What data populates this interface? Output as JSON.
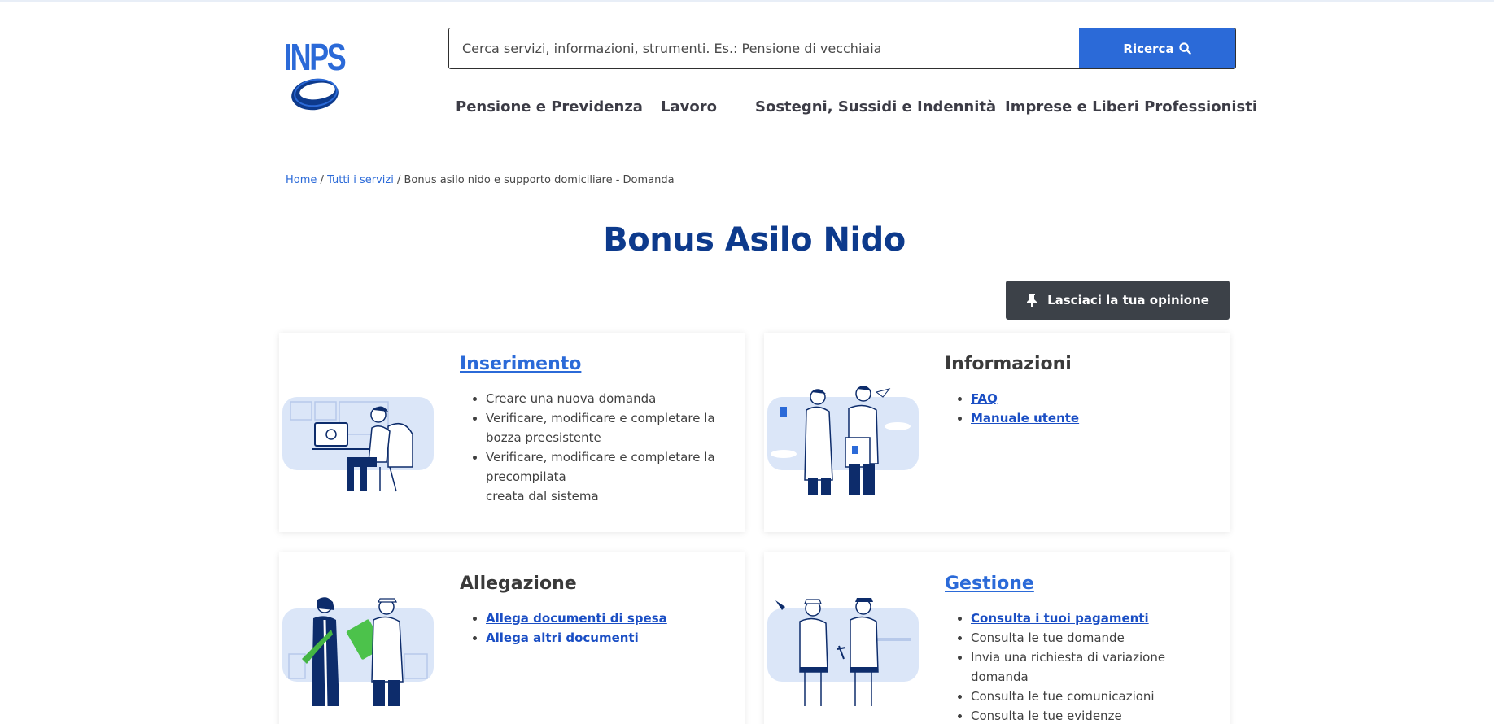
{
  "header": {
    "logo_text": "INPS",
    "search": {
      "placeholder": "Cerca servizi, informazioni, strumenti. Es.: Pensione di vecchiaia",
      "button_label": "Ricerca"
    },
    "nav": [
      {
        "label": "Pensione e Previdenza"
      },
      {
        "label": "Lavoro"
      },
      {
        "label": "Sostegni, Sussidi e Indennità"
      },
      {
        "label": "Imprese e Liberi Professionisti"
      }
    ]
  },
  "breadcrumb": {
    "home": "Home",
    "services": "Tutti i servizi",
    "current": "Bonus asilo nido e supporto domiciliare - Domanda",
    "separator": "/"
  },
  "page": {
    "title": "Bonus Asilo Nido",
    "opinion_button": "Lasciaci la tua opinione"
  },
  "cards": {
    "inserimento": {
      "title": "Inserimento",
      "items": [
        "Creare una nuova domanda",
        "Verificare, modificare e completare la bozza preesistente",
        "Verificare, modificare e completare la precompilata",
        "creata dal sistema"
      ]
    },
    "informazioni": {
      "title": "Informazioni",
      "items": [
        "FAQ",
        "Manuale utente"
      ]
    },
    "allegazione": {
      "title": "Allegazione",
      "items": [
        "Allega documenti di spesa",
        "Allega altri documenti"
      ]
    },
    "gestione": {
      "title": "Gestione",
      "items": [
        "Consulta i tuoi pagamenti",
        "Consulta le tue domande",
        "Invia una richiesta di variazione domanda",
        "Consulta le tue comunicazioni",
        "Consulta le tue evidenze"
      ]
    }
  },
  "colors": {
    "brand_blue": "#2b6ad8",
    "title_blue": "#0d3a8c",
    "dark_button": "#3c4148",
    "illustration_bg": "#dbe6f8"
  }
}
